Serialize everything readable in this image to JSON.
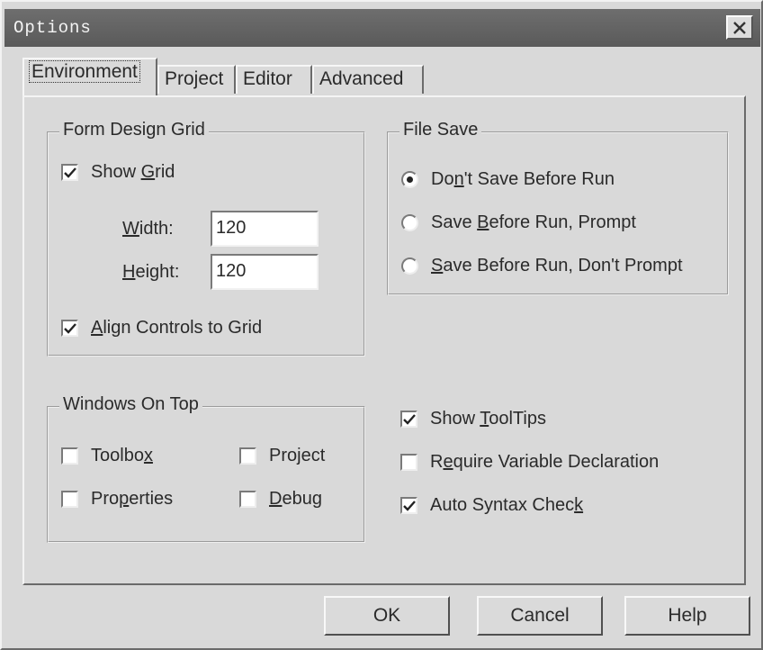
{
  "window": {
    "title": "Options"
  },
  "tabs": [
    {
      "label": "Environment",
      "active": true
    },
    {
      "label": "Project",
      "active": false
    },
    {
      "label": "Editor",
      "active": false
    },
    {
      "label": "Advanced",
      "active": false
    }
  ],
  "form_design_grid": {
    "title": "Form Design Grid",
    "show_grid": {
      "label_pre": "Show ",
      "label_key": "G",
      "label_post": "rid",
      "checked": true
    },
    "width": {
      "label_pre": "",
      "label_key": "W",
      "label_post": "idth:",
      "value": "120"
    },
    "height": {
      "label_pre": "",
      "label_key": "H",
      "label_post": "eight:",
      "value": "120"
    },
    "align_controls": {
      "label_pre": "",
      "label_key": "A",
      "label_post": "lign Controls to Grid",
      "checked": true
    }
  },
  "file_save": {
    "title": "File Save",
    "options": [
      {
        "label_pre": "Do",
        "label_key": "n",
        "label_post": "'t Save Before Run",
        "selected": true
      },
      {
        "label_pre": "Save ",
        "label_key": "B",
        "label_post": "efore Run, Prompt",
        "selected": false
      },
      {
        "label_pre": "",
        "label_key": "S",
        "label_post": "ave Before Run, Don't Prompt",
        "selected": false
      }
    ]
  },
  "windows_on_top": {
    "title": "Windows On Top",
    "toolbox": {
      "label_pre": "Toolbo",
      "label_key": "x",
      "label_post": "",
      "checked": false
    },
    "project": {
      "label_pre": "Project",
      "label_key": "",
      "label_post": "",
      "checked": false
    },
    "properties": {
      "label_pre": "Pro",
      "label_key": "p",
      "label_post": "erties",
      "checked": false
    },
    "debug": {
      "label_pre": "",
      "label_key": "D",
      "label_post": "ebug",
      "checked": false
    }
  },
  "misc": {
    "show_tooltips": {
      "label_pre": "Show ",
      "label_key": "T",
      "label_post": "oolTips",
      "checked": true
    },
    "require_var": {
      "label_pre": "R",
      "label_key": "e",
      "label_post": "quire Variable Declaration",
      "checked": false
    },
    "auto_syntax": {
      "label_pre": "Auto Syntax Chec",
      "label_key": "k",
      "label_post": "",
      "checked": true
    }
  },
  "buttons": {
    "ok": "OK",
    "cancel": "Cancel",
    "help": "Help"
  },
  "icons": {
    "close": "close-icon",
    "check": "checkmark-icon",
    "radio_dot": "radio-dot-icon"
  }
}
